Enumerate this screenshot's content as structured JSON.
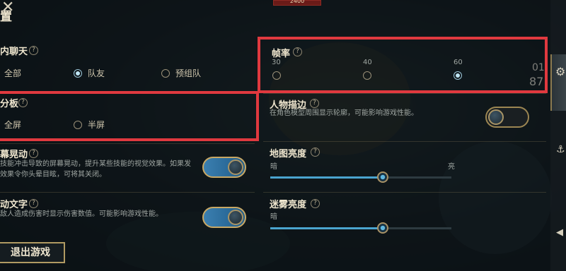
{
  "header": {
    "title": "置",
    "close_icon": "close-icon",
    "hp_value": "2400"
  },
  "team_chat": {
    "title": "内聊天",
    "help": "?",
    "options": [
      {
        "label": "全部",
        "selected": false
      },
      {
        "label": "队友",
        "selected": true
      },
      {
        "label": "预组队",
        "selected": false
      }
    ]
  },
  "frame_rate": {
    "title": "帧率",
    "help": "?",
    "options": [
      {
        "label": "30",
        "selected": false
      },
      {
        "label": "40",
        "selected": false
      },
      {
        "label": "60",
        "selected": true
      }
    ]
  },
  "scoreboard": {
    "title": "分板",
    "help": "?",
    "options": [
      {
        "label": "全屏",
        "selected": false
      },
      {
        "label": "半屏",
        "selected": false
      }
    ]
  },
  "character_outline": {
    "title": "人物描边",
    "help": "?",
    "desc": "在角色模型周围显示轮廓，可能影响游戏性能。",
    "enabled": false
  },
  "screen_shake": {
    "title": "幕晃动",
    "help": "?",
    "desc_line1": "技能冲击导致的屏幕晃动，提升某些技能的视觉效果。如果发",
    "desc_line2": "效果令你头晕目眩，可将其关闭。",
    "enabled": true
  },
  "map_brightness": {
    "title": "地图亮度",
    "help": "?",
    "min_label": "暗",
    "max_label": "亮",
    "value": 0.62
  },
  "damage_text": {
    "title": "动文字",
    "help": "?",
    "desc": "敌人造成伤害时显示伤害数值。可能影响游戏性能。",
    "enabled": true
  },
  "fog_brightness": {
    "title": "迷雾亮度",
    "help": "?",
    "min_label": "暗",
    "value": 0.62
  },
  "exit_button": {
    "label": "退出游戏"
  },
  "sidebar": {
    "icons": [
      "gear-icon",
      "anchor-icon",
      "speaker-icon"
    ]
  },
  "hud": {
    "left_value": "01",
    "left_value2": "87"
  },
  "colors": {
    "highlight": "#e0393f",
    "accent": "#4aa4cf",
    "gold": "#b09a62"
  }
}
